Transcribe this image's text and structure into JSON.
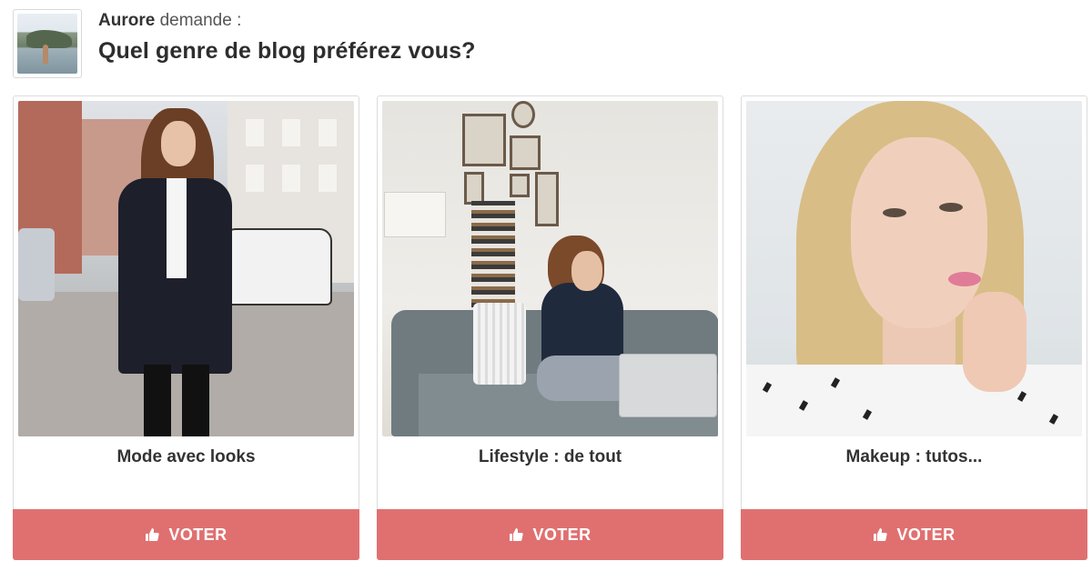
{
  "header": {
    "asker_name": "Aurore",
    "asker_verb": "demande :",
    "question": "Quel genre de blog préférez vous?"
  },
  "options": [
    {
      "label": "Mode avec looks",
      "vote_label": "VOTER"
    },
    {
      "label": "Lifestyle : de tout",
      "vote_label": "VOTER"
    },
    {
      "label": "Makeup : tutos...",
      "vote_label": "VOTER"
    }
  ],
  "colors": {
    "vote_button": "#e07070",
    "title_text": "#2d2d2d"
  },
  "icons": {
    "vote": "thumbs-up-icon"
  }
}
